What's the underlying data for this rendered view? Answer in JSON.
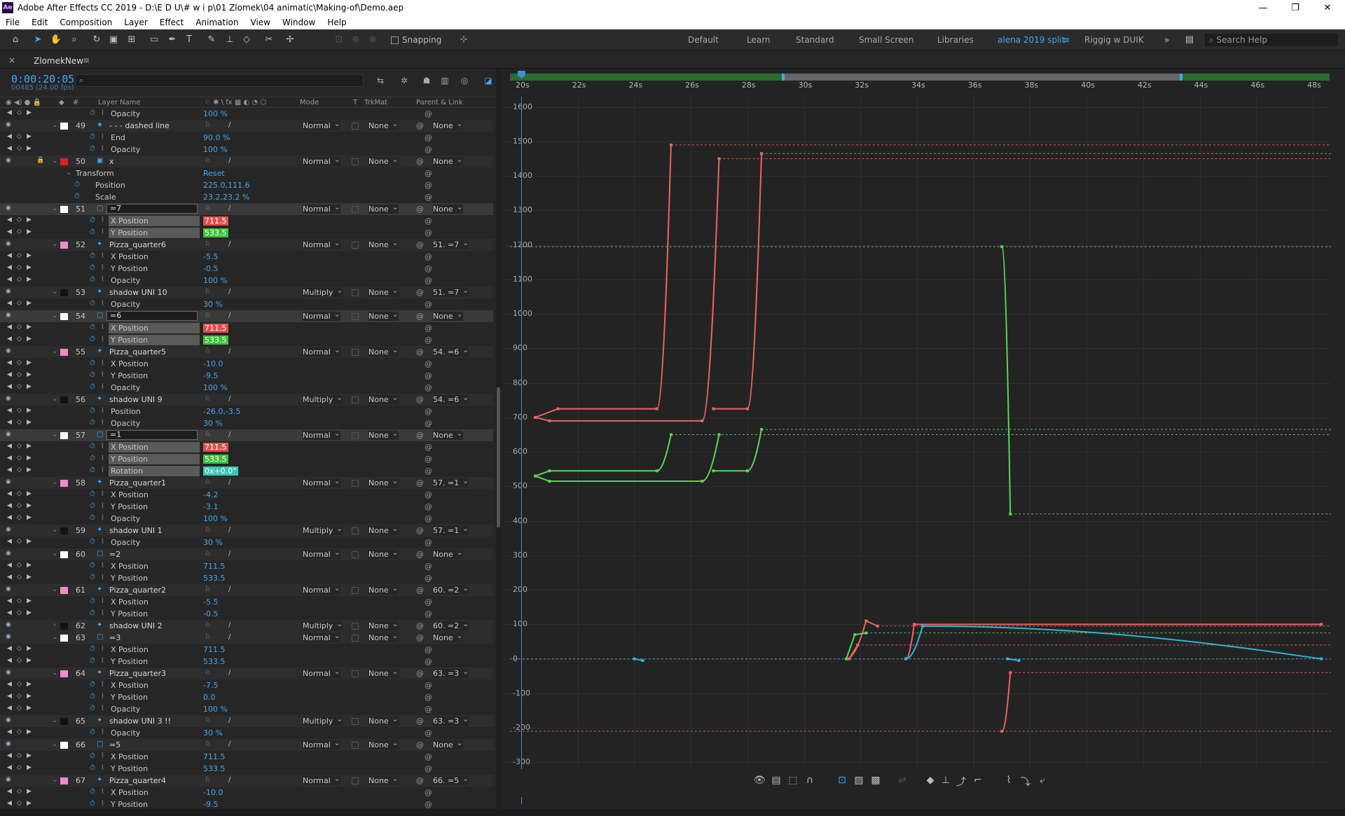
{
  "titlebar": {
    "title": "Adobe After Effects CC 2019 - D:\\E D U\\# w i p\\01 Zlomek\\04 animatic\\Making-of\\Demo.aep",
    "minimize": "—",
    "maximize": "❐",
    "close": "✕"
  },
  "menu": [
    "File",
    "Edit",
    "Composition",
    "Layer",
    "Effect",
    "Animation",
    "View",
    "Window",
    "Help"
  ],
  "toolbar": {
    "snapping": "Snapping",
    "workspaces": [
      "Default",
      "Learn",
      "Standard",
      "Small Screen",
      "Libraries",
      "alena 2019 split",
      "Riggig w DUIK"
    ],
    "active_workspace": "alena 2019 split",
    "search_help": "Search Help",
    "accent": "#3fa9f5"
  },
  "comp": {
    "tab_close": "×",
    "name": "ZlomekNew",
    "tab_menu": "≡",
    "timecode": "0:00:20:05",
    "frames": "00485 (24.00 fps)"
  },
  "columns": {
    "layer_name": "Layer Name",
    "mode": "Mode",
    "t": "T",
    "trkmat": "TrkMat",
    "parent": "Parent & Link",
    "hash": "#"
  },
  "rows": [
    {
      "k": "prop",
      "name": "Opacity",
      "val": "100 %"
    },
    {
      "k": "layer",
      "num": "49",
      "sw": "#ffffff",
      "icon": "★",
      "name": "- - - dashed line",
      "mode": "Normal",
      "trk": "None",
      "parent": "None"
    },
    {
      "k": "prop",
      "name": "End",
      "val": "90.0 %"
    },
    {
      "k": "prop",
      "name": "Opacity",
      "val": "100 %"
    },
    {
      "k": "layer",
      "num": "50",
      "sw": "#e02020",
      "icon": "▣",
      "name": "x",
      "mode": "Normal",
      "trk": "None",
      "parent": "None",
      "lock": true
    },
    {
      "k": "group",
      "name": "Transform",
      "val": "Reset"
    },
    {
      "k": "prop2",
      "name": "Position",
      "val": "225.0,111.6"
    },
    {
      "k": "prop2",
      "name": "Scale",
      "val": "23.2,23.2 %"
    },
    {
      "k": "layer",
      "num": "51",
      "sw": "#ffffff",
      "icon": "□",
      "name": "=7",
      "mode": "Normal",
      "trk": "None",
      "parent": "None",
      "box": true
    },
    {
      "k": "prop",
      "name": "X Position",
      "val": "711.5",
      "hl": "#e05050"
    },
    {
      "k": "prop",
      "name": "Y Position",
      "val": "533.5",
      "hl": "#3cc43c"
    },
    {
      "k": "layer",
      "num": "52",
      "sw": "#f08ccf",
      "icon": "✦",
      "name": "Pizza_quarter6",
      "mode": "Normal",
      "trk": "None",
      "parent": "51. =7"
    },
    {
      "k": "prop",
      "name": "X Position",
      "val": "-5.5"
    },
    {
      "k": "prop",
      "name": "Y Position",
      "val": "-0.5"
    },
    {
      "k": "prop",
      "name": "Opacity",
      "val": "100 %"
    },
    {
      "k": "layer",
      "num": "53",
      "sw": "#111111",
      "icon": "✦",
      "name": "shadow UNI 10",
      "mode": "Multiply",
      "trk": "None",
      "parent": "51. =7"
    },
    {
      "k": "prop",
      "name": "Opacity",
      "val": "30 %"
    },
    {
      "k": "layer",
      "num": "54",
      "sw": "#ffffff",
      "icon": "□",
      "name": "=6",
      "mode": "Normal",
      "trk": "None",
      "parent": "None",
      "box": true
    },
    {
      "k": "prop",
      "name": "X Position",
      "val": "711.5",
      "hl": "#e05050"
    },
    {
      "k": "prop",
      "name": "Y Position",
      "val": "533.5",
      "hl": "#3cc43c"
    },
    {
      "k": "layer",
      "num": "55",
      "sw": "#f08ccf",
      "icon": "✦",
      "name": "Pizza_quarter5",
      "mode": "Normal",
      "trk": "None",
      "parent": "54. =6"
    },
    {
      "k": "prop",
      "name": "X Position",
      "val": "-10.0"
    },
    {
      "k": "prop",
      "name": "Y Position",
      "val": "-9.5"
    },
    {
      "k": "prop",
      "name": "Opacity",
      "val": "100 %"
    },
    {
      "k": "layer",
      "num": "56",
      "sw": "#111111",
      "icon": "✦",
      "name": "shadow UNI 9",
      "mode": "Multiply",
      "trk": "None",
      "parent": "54. =6"
    },
    {
      "k": "prop",
      "name": "Position",
      "val": "-26.0,-3.5"
    },
    {
      "k": "prop",
      "name": "Opacity",
      "val": "30 %"
    },
    {
      "k": "layer",
      "num": "57",
      "sw": "#ffffff",
      "icon": "□",
      "name": "=1",
      "mode": "Normal",
      "trk": "None",
      "parent": "None",
      "box": true
    },
    {
      "k": "prop",
      "name": "X Position",
      "val": "711.5",
      "hl": "#e05050"
    },
    {
      "k": "prop",
      "name": "Y Position",
      "val": "533.5",
      "hl": "#3cc43c"
    },
    {
      "k": "prop",
      "name": "Rotation",
      "val": "0x+0.0°",
      "hl": "#3cc4b4"
    },
    {
      "k": "layer",
      "num": "58",
      "sw": "#f08ccf",
      "icon": "✦",
      "name": "Pizza_quarter1",
      "mode": "Normal",
      "trk": "None",
      "parent": "57. =1"
    },
    {
      "k": "prop",
      "name": "X Position",
      "val": "-4.2"
    },
    {
      "k": "prop",
      "name": "Y Position",
      "val": "-3.1"
    },
    {
      "k": "prop",
      "name": "Opacity",
      "val": "100 %"
    },
    {
      "k": "layer",
      "num": "59",
      "sw": "#111111",
      "icon": "✦",
      "name": "shadow UNI 1",
      "mode": "Multiply",
      "trk": "None",
      "parent": "57. =1"
    },
    {
      "k": "prop",
      "name": "Opacity",
      "val": "30 %"
    },
    {
      "k": "layer",
      "num": "60",
      "sw": "#ffffff",
      "icon": "□",
      "name": "=2",
      "mode": "Normal",
      "trk": "None",
      "parent": "None"
    },
    {
      "k": "prop",
      "name": "X Position",
      "val": "711.5"
    },
    {
      "k": "prop",
      "name": "Y Position",
      "val": "533.5"
    },
    {
      "k": "layer",
      "num": "61",
      "sw": "#f08ccf",
      "icon": "✦",
      "name": "Pizza_quarter2",
      "mode": "Normal",
      "trk": "None",
      "parent": "60. =2"
    },
    {
      "k": "prop",
      "name": "X Position",
      "val": "-5.5"
    },
    {
      "k": "prop",
      "name": "Y Position",
      "val": "-0.5"
    },
    {
      "k": "layer",
      "num": "62",
      "sw": "#111111",
      "icon": "✦",
      "name": "shadow UNI 2",
      "mode": "Multiply",
      "trk": "None",
      "parent": "60. =2",
      "collapsed": true
    },
    {
      "k": "layer",
      "num": "63",
      "sw": "#ffffff",
      "icon": "□",
      "name": "=3",
      "mode": "Normal",
      "trk": "None",
      "parent": "None"
    },
    {
      "k": "prop",
      "name": "X Position",
      "val": "711.5"
    },
    {
      "k": "prop",
      "name": "Y Position",
      "val": "533.5"
    },
    {
      "k": "layer",
      "num": "64",
      "sw": "#f08ccf",
      "icon": "✦",
      "name": "Pizza_quarter3",
      "mode": "Normal",
      "trk": "None",
      "parent": "63. =3"
    },
    {
      "k": "prop",
      "name": "X Position",
      "val": "-7.5"
    },
    {
      "k": "prop",
      "name": "Y Position",
      "val": "0.0"
    },
    {
      "k": "prop",
      "name": "Opacity",
      "val": "100 %"
    },
    {
      "k": "layer",
      "num": "65",
      "sw": "#111111",
      "icon": "✦",
      "name": "shadow UNI 3 !!",
      "mode": "Multiply",
      "trk": "None",
      "parent": "63. =3"
    },
    {
      "k": "prop",
      "name": "Opacity",
      "val": "30 %"
    },
    {
      "k": "layer",
      "num": "66",
      "sw": "#ffffff",
      "icon": "□",
      "name": "=5",
      "mode": "Normal",
      "trk": "None",
      "parent": "None"
    },
    {
      "k": "prop",
      "name": "X Position",
      "val": "711.5"
    },
    {
      "k": "prop",
      "name": "Y Position",
      "val": "533.5"
    },
    {
      "k": "layer",
      "num": "67",
      "sw": "#f08ccf",
      "icon": "✦",
      "name": "Pizza_quarter4",
      "mode": "Normal",
      "trk": "None",
      "parent": "66. =5"
    },
    {
      "k": "prop",
      "name": "X Position",
      "val": "-10.0"
    },
    {
      "k": "prop",
      "name": "Y Position",
      "val": "-9.5"
    }
  ],
  "chart_data": {
    "type": "line",
    "xlabel": "",
    "ylabel": "",
    "xlim": [
      19.6,
      48.4
    ],
    "ylim": [
      -340,
      1630
    ],
    "x_ticks": [
      "20s",
      "22s",
      "24s",
      "26s",
      "28s",
      "30s",
      "32s",
      "34s",
      "36s",
      "38s",
      "40s",
      "42s",
      "44s",
      "46s",
      "48s"
    ],
    "y_ticks": [
      1600,
      1500,
      1400,
      1300,
      1200,
      1100,
      1000,
      900,
      800,
      700,
      600,
      500,
      400,
      300,
      200,
      100,
      0,
      -100,
      -200,
      -300
    ],
    "grid": true,
    "colors": {
      "x_position": "#e86464",
      "y_position": "#55d655",
      "rotation": "#2fb4d6"
    },
    "series": [
      {
        "name": "X Position",
        "color": "#e86464",
        "points": [
          [
            20.5,
            700
          ],
          [
            21.3,
            725
          ],
          [
            24.8,
            725
          ],
          [
            25.3,
            1490
          ]
        ]
      },
      {
        "name": "X Position",
        "color": "#e86464",
        "points": [
          [
            20.5,
            700
          ],
          [
            21.0,
            690
          ],
          [
            26.4,
            690
          ],
          [
            27.0,
            1450
          ]
        ]
      },
      {
        "name": "X Position",
        "color": "#e86464",
        "points": [
          [
            26.8,
            725
          ],
          [
            28.0,
            725
          ],
          [
            28.5,
            1465
          ]
        ]
      },
      {
        "name": "Y Position",
        "color": "#55d655",
        "points": [
          [
            20.5,
            530
          ],
          [
            21.0,
            545
          ],
          [
            24.8,
            545
          ],
          [
            25.3,
            650
          ]
        ]
      },
      {
        "name": "Y Position",
        "color": "#55d655",
        "points": [
          [
            20.5,
            530
          ],
          [
            21.0,
            515
          ],
          [
            26.4,
            515
          ],
          [
            27.0,
            650
          ]
        ]
      },
      {
        "name": "Y Position",
        "color": "#55d655",
        "points": [
          [
            26.8,
            545
          ],
          [
            28.0,
            545
          ],
          [
            28.5,
            665
          ]
        ]
      },
      {
        "name": "Y Position",
        "color": "#55d655",
        "points": [
          [
            37.0,
            1195
          ],
          [
            37.3,
            420
          ]
        ]
      },
      {
        "name": "X Position",
        "color": "#e86464",
        "points": [
          [
            31.5,
            0
          ],
          [
            32.2,
            110
          ],
          [
            32.6,
            95
          ]
        ]
      },
      {
        "name": "Y Position",
        "color": "#55d655",
        "points": [
          [
            31.5,
            0
          ],
          [
            31.8,
            70
          ],
          [
            32.2,
            75
          ]
        ]
      },
      {
        "name": "X Position",
        "color": "#e86464",
        "points": [
          [
            31.6,
            0
          ],
          [
            31.9,
            40
          ]
        ]
      },
      {
        "name": "X Position",
        "color": "#e86464",
        "points": [
          [
            33.6,
            0
          ],
          [
            33.9,
            100
          ],
          [
            48.3,
            100
          ]
        ]
      },
      {
        "name": "Rotation",
        "color": "#2fb4d6",
        "points": [
          [
            33.6,
            0
          ],
          [
            34.2,
            95
          ],
          [
            48.3,
            0
          ]
        ]
      },
      {
        "name": "Rotation",
        "color": "#2fb4d6",
        "points": [
          [
            24.0,
            0
          ],
          [
            24.3,
            -5
          ]
        ]
      },
      {
        "name": "Rotation",
        "color": "#2fb4d6",
        "points": [
          [
            37.2,
            0
          ],
          [
            37.6,
            -5
          ]
        ]
      },
      {
        "name": "X Position",
        "color": "#e86464",
        "points": [
          [
            37.0,
            -210
          ],
          [
            37.3,
            -40
          ]
        ]
      }
    ],
    "dashed_levels": [
      {
        "color": "#e86464",
        "y": 1490,
        "x_from": 25.3
      },
      {
        "color": "#e86464",
        "y": 1465,
        "x_from": 28.5
      },
      {
        "color": "#e86464",
        "y": 1450,
        "x_from": 27.0
      },
      {
        "color": "#55d655",
        "y": 1195,
        "x_from": 19.6
      },
      {
        "color": "#55d655",
        "y": 665,
        "x_from": 28.5
      },
      {
        "color": "#55d655",
        "y": 650,
        "x_from": 25.3
      },
      {
        "color": "#55d655",
        "y": 420,
        "x_from": 37.3
      },
      {
        "color": "#e86464",
        "y": 95,
        "x_from": 32.6
      },
      {
        "color": "#55d655",
        "y": 75,
        "x_from": 32.2
      },
      {
        "color": "#e86464",
        "y": 40,
        "x_from": 31.9
      },
      {
        "color": "#2fb4d6",
        "y": 0,
        "x_from": 19.6
      },
      {
        "color": "#e86464",
        "y": -40,
        "x_from": 37.3
      },
      {
        "color": "#e86464",
        "y": -210,
        "x_from": 19.6
      }
    ]
  }
}
